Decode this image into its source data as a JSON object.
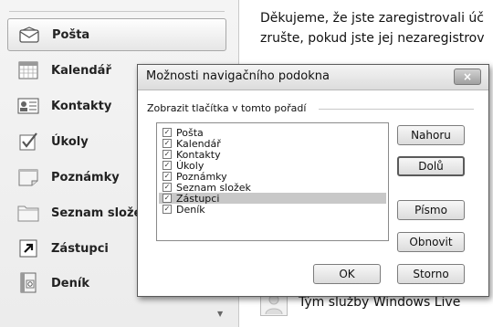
{
  "nav": {
    "items": [
      {
        "label": "Pošta",
        "icon": "mail-envelope-icon",
        "selected": true
      },
      {
        "label": "Kalendář",
        "icon": "calendar-grid-icon",
        "selected": false
      },
      {
        "label": "Kontakty",
        "icon": "contact-card-icon",
        "selected": false
      },
      {
        "label": "Úkoly",
        "icon": "checklist-icon",
        "selected": false
      },
      {
        "label": "Poznámky",
        "icon": "note-icon",
        "selected": false
      },
      {
        "label": "Seznam složek",
        "icon": "folder-icon",
        "selected": false
      },
      {
        "label": "Zástupci",
        "icon": "shortcut-arrow-icon",
        "selected": false
      },
      {
        "label": "Deník",
        "icon": "journal-book-icon",
        "selected": false
      }
    ]
  },
  "content": {
    "line1": "Děkujeme, že jste zaregistrovali úč",
    "line2": "zrušte, pokud jste jej nezaregistrov",
    "contact_name": "Tým služby Windows Live"
  },
  "dialog": {
    "title": "Možnosti navigačního podokna",
    "close_symbol": "×",
    "group_label": "Zobrazit tlačítka v tomto pořadí",
    "list": [
      {
        "label": "Pošta",
        "checked": true
      },
      {
        "label": "Kalendář",
        "checked": true
      },
      {
        "label": "Kontakty",
        "checked": true
      },
      {
        "label": "Úkoly",
        "checked": true
      },
      {
        "label": "Poznámky",
        "checked": true
      },
      {
        "label": "Seznam složek",
        "checked": true
      },
      {
        "label": "Zástupci",
        "checked": true
      },
      {
        "label": "Deník",
        "checked": true
      }
    ],
    "selected_index": 6,
    "buttons": {
      "up": "Nahoru",
      "down": "Dolů",
      "font": "Písmo",
      "reset": "Obnovit",
      "ok": "OK",
      "cancel": "Storno"
    }
  },
  "colors": {
    "selection": "#c8c8c8",
    "dialog_border": "#5a5a5a"
  }
}
